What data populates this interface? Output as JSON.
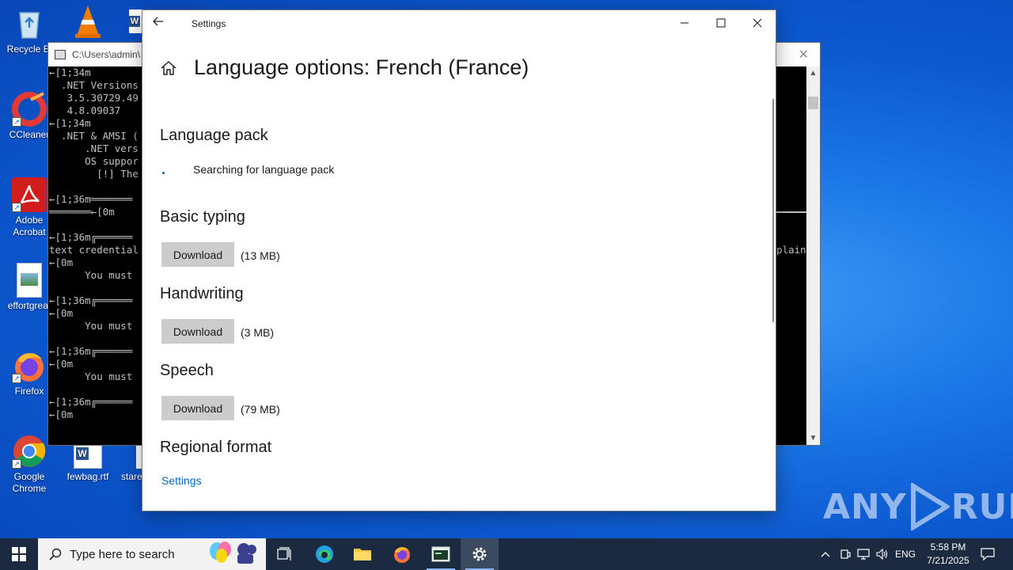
{
  "desktop": {
    "icons": [
      {
        "label": "Recycle Bin",
        "label_visible": "Recycle Bi"
      },
      {
        "label": "CCleaner"
      },
      {
        "label": "Adobe Acrobat",
        "line1": "Adobe",
        "line2": "Acrobat"
      },
      {
        "label": "effortgreat"
      },
      {
        "label": "Firefox"
      },
      {
        "label": "Google Chrome",
        "line1": "Google",
        "line2": "Chrome"
      },
      {
        "label": "fewbag.rtf"
      },
      {
        "label": "stare"
      }
    ],
    "watermark": "ANY RUN"
  },
  "console": {
    "title": "C:\\Users\\admin\\",
    "lines": [
      "←[1;34m",
      "  .NET Versions",
      "   3.5.30729.49",
      "   4.8.09037",
      "←[1;34m",
      "  .NET & AMSI (",
      "      .NET vers",
      "      OS suppor",
      "        [!] The",
      "",
      "←[1;36m═══════",
      "═══════←[0m",
      "",
      "←[1;36m╔══════",
      "text credential",
      "←[0m",
      "      You must",
      "",
      "←[1;36m╔══════",
      "←[0m",
      "      You must",
      "",
      "←[1;36m╔══════",
      "←[0m",
      "      You must",
      "",
      "←[1;36m╔══════",
      "←[0m"
    ],
    "right_text": "plain"
  },
  "settings": {
    "window_title": "Settings",
    "page_title": "Language options: French (France)",
    "language_pack": {
      "heading": "Language pack",
      "status": "Searching for language pack"
    },
    "basic_typing": {
      "heading": "Basic typing",
      "button": "Download",
      "size": "(13 MB)"
    },
    "handwriting": {
      "heading": "Handwriting",
      "button": "Download",
      "size": "(3 MB)"
    },
    "speech": {
      "heading": "Speech",
      "button": "Download",
      "size": "(79 MB)"
    },
    "regional_format": {
      "heading": "Regional format",
      "link": "Settings"
    }
  },
  "taskbar": {
    "search_placeholder": "Type here to search",
    "language": "ENG",
    "time": "5:58 PM",
    "date": "7/21/2025"
  }
}
